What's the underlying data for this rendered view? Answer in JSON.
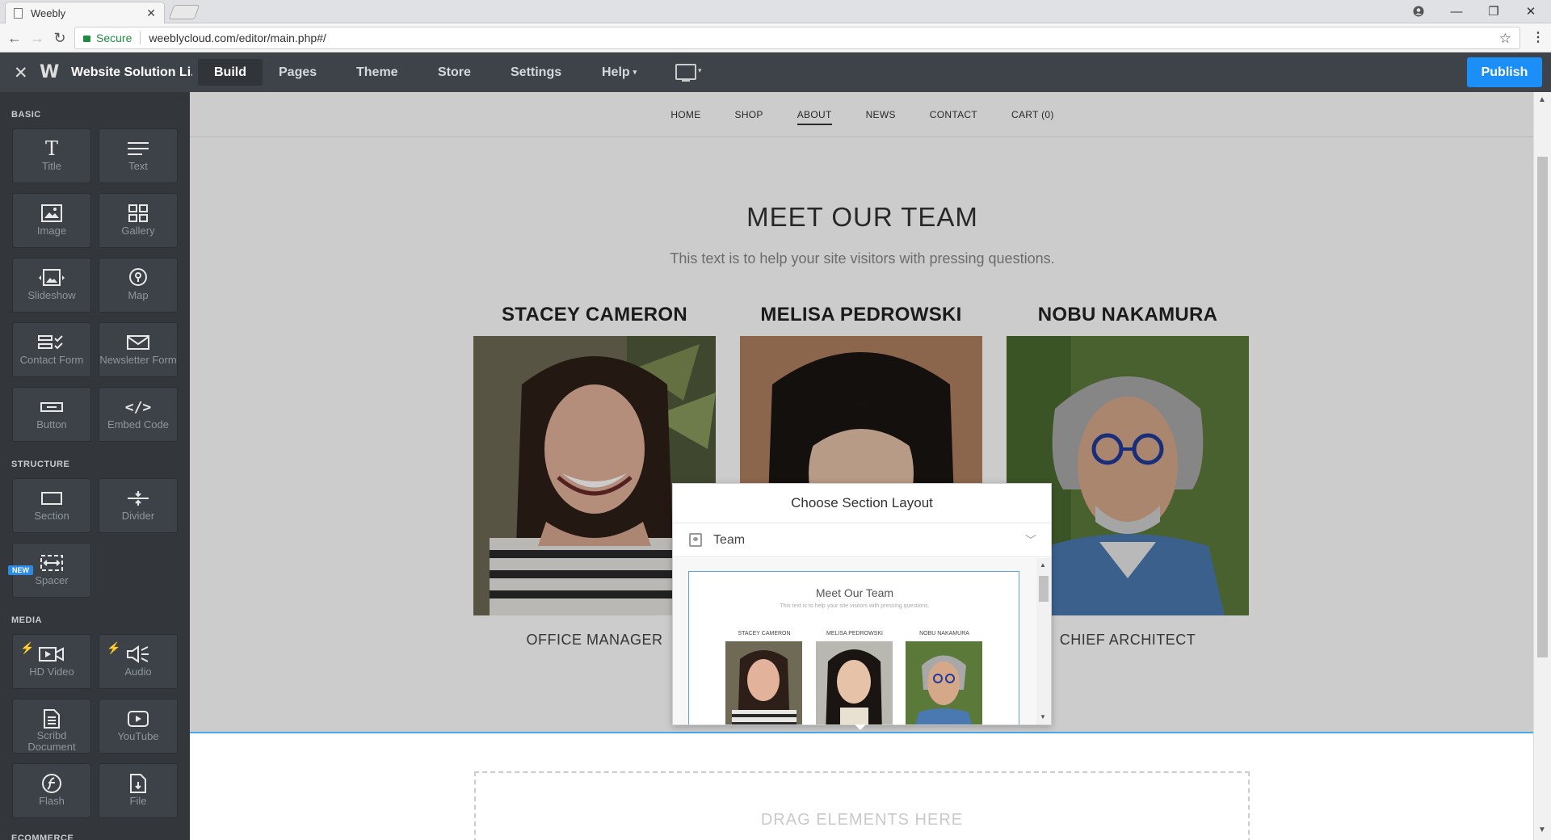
{
  "browser": {
    "tab_title": "Weebly",
    "tab_close": "✕",
    "window_controls": {
      "minimize": "—",
      "maximize": "❐",
      "close": "✕"
    },
    "secure_label": "Secure",
    "url": "weeblycloud.com/editor/main.php#/"
  },
  "editor": {
    "close_icon": "✕",
    "logo": "W",
    "site_name": "Website Solution Li...",
    "nav": [
      {
        "label": "Build",
        "active": true
      },
      {
        "label": "Pages"
      },
      {
        "label": "Theme"
      },
      {
        "label": "Store"
      },
      {
        "label": "Settings"
      },
      {
        "label": "Help"
      }
    ],
    "help_caret": "▾",
    "device_caret": "▾",
    "publish_label": "Publish"
  },
  "sidebar": {
    "sections": {
      "basic": "BASIC",
      "structure": "STRUCTURE",
      "media": "MEDIA",
      "ecommerce": "ECOMMERCE"
    },
    "new_badge": "NEW",
    "tiles": {
      "title": {
        "label": "Title",
        "icon": "title-icon"
      },
      "text": {
        "label": "Text",
        "icon": "text-lines-icon"
      },
      "image": {
        "label": "Image",
        "icon": "image-icon"
      },
      "gallery": {
        "label": "Gallery",
        "icon": "gallery-grid-icon"
      },
      "slideshow": {
        "label": "Slideshow",
        "icon": "slideshow-icon"
      },
      "map": {
        "label": "Map",
        "icon": "map-pin-icon"
      },
      "contact_form": {
        "label": "Contact Form",
        "icon": "form-icon"
      },
      "newsletter_form": {
        "label": "Newsletter Form",
        "icon": "envelope-icon"
      },
      "button": {
        "label": "Button",
        "icon": "button-icon"
      },
      "embed_code": {
        "label": "Embed Code",
        "icon": "code-icon"
      },
      "section": {
        "label": "Section",
        "icon": "section-icon"
      },
      "divider": {
        "label": "Divider",
        "icon": "divider-icon"
      },
      "spacer": {
        "label": "Spacer",
        "icon": "spacer-icon"
      },
      "hd_video": {
        "label": "HD Video",
        "icon": "video-icon"
      },
      "audio": {
        "label": "Audio",
        "icon": "speaker-icon"
      },
      "scribd": {
        "label": "Scribd Document",
        "icon": "document-icon"
      },
      "youtube": {
        "label": "YouTube",
        "icon": "youtube-play-icon"
      },
      "flash": {
        "label": "Flash",
        "icon": "flash-icon"
      },
      "file": {
        "label": "File",
        "icon": "file-icon"
      }
    }
  },
  "site": {
    "nav": [
      "HOME",
      "SHOP",
      "ABOUT",
      "NEWS",
      "CONTACT",
      "CART (0)"
    ],
    "active_nav": "ABOUT",
    "title": "MEET OUR TEAM",
    "subtitle": "This text is to help your site visitors with pressing questions.",
    "members": [
      {
        "name": "STACEY CAMERON",
        "role": "OFFICE MANAGER"
      },
      {
        "name": "MELISA PEDROWSKI",
        "role": ""
      },
      {
        "name": "NOBU NAKAMURA",
        "role": "CHIEF ARCHITECT"
      }
    ],
    "drop_zone": "DRAG ELEMENTS HERE"
  },
  "popup": {
    "title": "Choose Section Layout",
    "selected": "Team",
    "preview": {
      "title": "Meet Our Team",
      "subtitle": "This text is to help your site visitors with pressing questions.",
      "names": [
        "STACEY CAMERON",
        "MELISA PEDROWSKI",
        "NOBU NAKAMURA"
      ]
    }
  },
  "colors": {
    "publish": "#1b8ef7",
    "topbar": "#3e4349",
    "sidebar": "#33373c",
    "section_line": "#4aa8f0"
  }
}
